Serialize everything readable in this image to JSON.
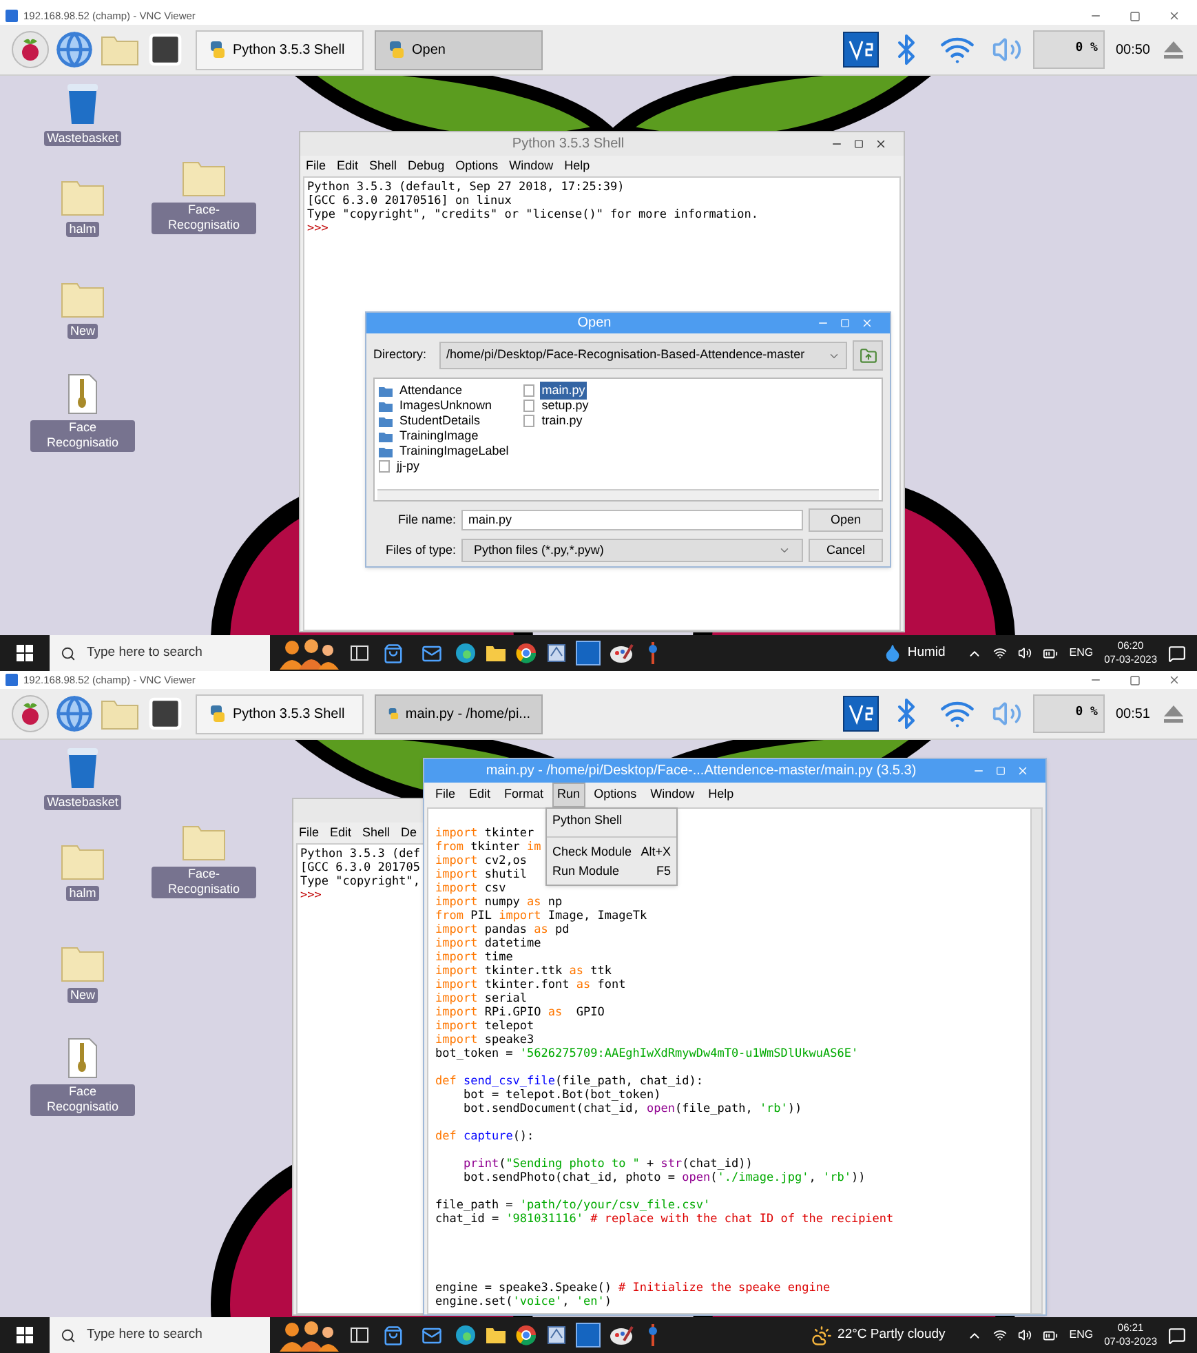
{
  "screens": [
    {
      "vnc_title": "192.168.98.52 (champ) - VNC Viewer",
      "pi_taskbar": {
        "tasks": [
          {
            "label": "Python 3.5.3 Shell",
            "selected": false
          },
          {
            "label": "Open",
            "selected": true
          }
        ],
        "cpu": "0 %",
        "clock": "00:50"
      },
      "desktop_icons": [
        {
          "kind": "trash",
          "label": "Wastebasket"
        },
        {
          "kind": "folder",
          "label": "halm"
        },
        {
          "kind": "folder",
          "label": "Face-Recognisatio"
        },
        {
          "kind": "folder",
          "label": "New"
        },
        {
          "kind": "zip",
          "label": "Face Recognisatio"
        }
      ],
      "windows": [
        {
          "kind": "shell",
          "title": "Python 3.5.3 Shell",
          "menu": [
            "File",
            "Edit",
            "Shell",
            "Debug",
            "Options",
            "Window",
            "Help"
          ],
          "lines": [
            {
              "kind": "output",
              "text": "Python 3.5.3 (default, Sep 27 2018, 17:25:39)"
            },
            {
              "kind": "output",
              "text": "[GCC 6.3.0 20170516] on linux"
            },
            {
              "kind": "output",
              "text": "Type \"copyright\", \"credits\" or \"license()\" for more information."
            },
            {
              "kind": "prompt",
              "text": ">>>"
            }
          ]
        },
        {
          "kind": "open_dialog",
          "title": "Open",
          "directory_label": "Directory:",
          "directory": "/home/pi/Desktop/Face-Recognisation-Based-Attendence-master",
          "file_columns": [
            {
              "items": [
                {
                  "kind": "folder",
                  "label": "Attendance",
                  "selected": false
                },
                {
                  "kind": "folder",
                  "label": "ImagesUnknown",
                  "selected": false
                },
                {
                  "kind": "folder",
                  "label": "StudentDetails",
                  "selected": false
                },
                {
                  "kind": "folder",
                  "label": "TrainingImage",
                  "selected": false
                },
                {
                  "kind": "folder",
                  "label": "TrainingImageLabel",
                  "selected": false
                },
                {
                  "kind": "file",
                  "label": "jj-py",
                  "selected": false
                }
              ]
            },
            {
              "items": [
                {
                  "kind": "file",
                  "label": "main.py",
                  "selected": true
                },
                {
                  "kind": "file",
                  "label": "setup.py",
                  "selected": false
                },
                {
                  "kind": "file",
                  "label": "train.py",
                  "selected": false
                }
              ]
            }
          ],
          "file_name_label": "File name:",
          "file_name": "main.py",
          "file_type_label": "Files of type:",
          "file_type": "Python files (*.py,*.pyw)",
          "buttons": [
            "Open",
            "Cancel"
          ]
        }
      ],
      "windows_taskbar": {
        "search_placeholder": "Type here to search",
        "weather": {
          "kind": "drop",
          "text": "Humid"
        },
        "language": "ENG",
        "time": "06:20",
        "date": "07-03-2023"
      }
    },
    {
      "vnc_title": "192.168.98.52 (champ) - VNC Viewer",
      "pi_taskbar": {
        "tasks": [
          {
            "label": "Python 3.5.3 Shell",
            "selected": false
          },
          {
            "label": "main.py - /home/pi...",
            "selected": true
          }
        ],
        "cpu": "0 %",
        "clock": "00:51"
      },
      "desktop_icons": [
        {
          "kind": "trash",
          "label": "Wastebasket"
        },
        {
          "kind": "folder",
          "label": "halm"
        },
        {
          "kind": "folder",
          "label": "Face-Recognisatio"
        },
        {
          "kind": "folder",
          "label": "New"
        },
        {
          "kind": "zip",
          "label": "Face Recognisatio"
        }
      ],
      "windows": [
        {
          "kind": "shell",
          "menu": [
            "File",
            "Edit",
            "Shell",
            "De"
          ],
          "lines": [
            {
              "kind": "output",
              "text": "Python 3.5.3 (def"
            },
            {
              "kind": "output",
              "text": "[GCC 6.3.0 201705"
            },
            {
              "kind": "output",
              "text": "Type \"copyright\","
            },
            {
              "kind": "prompt",
              "text": ">>>"
            }
          ]
        },
        {
          "kind": "editor",
          "title": "main.py - /home/pi/Desktop/Face-...Attendence-master/main.py (3.5.3)",
          "menu": [
            {
              "label": "File",
              "selected": false
            },
            {
              "label": "Edit",
              "selected": false
            },
            {
              "label": "Format",
              "selected": false
            },
            {
              "label": "Run",
              "selected": true
            },
            {
              "label": "Options",
              "selected": false
            },
            {
              "label": "Window",
              "selected": false
            },
            {
              "label": "Help",
              "selected": false
            }
          ],
          "dropdown": [
            {
              "kind": "item",
              "label": "Python Shell"
            },
            {
              "kind": "separator"
            },
            {
              "kind": "item",
              "label": "Check Module",
              "shortcut": "Alt+X"
            },
            {
              "kind": "item",
              "label": "Run Module",
              "shortcut": "F5"
            }
          ],
          "code": [
            {
              "kind": "code",
              "tokens": [
                {
                  "kind": "keyword",
                  "text": "import"
                },
                {
                  "kind": "plain",
                  "text": " tkinter"
                }
              ]
            },
            {
              "kind": "code",
              "tokens": [
                {
                  "kind": "keyword",
                  "text": "from"
                },
                {
                  "kind": "plain",
                  "text": " tkinter "
                },
                {
                  "kind": "keyword",
                  "text": "im"
                }
              ]
            },
            {
              "kind": "code",
              "tokens": [
                {
                  "kind": "keyword",
                  "text": "import"
                },
                {
                  "kind": "plain",
                  "text": " cv2,os"
                }
              ]
            },
            {
              "kind": "code",
              "tokens": [
                {
                  "kind": "keyword",
                  "text": "import"
                },
                {
                  "kind": "plain",
                  "text": " shutil"
                }
              ]
            },
            {
              "kind": "code",
              "tokens": [
                {
                  "kind": "keyword",
                  "text": "import"
                },
                {
                  "kind": "plain",
                  "text": " csv"
                }
              ]
            },
            {
              "kind": "code",
              "tokens": [
                {
                  "kind": "keyword",
                  "text": "import"
                },
                {
                  "kind": "plain",
                  "text": " numpy "
                },
                {
                  "kind": "keyword",
                  "text": "as"
                },
                {
                  "kind": "plain",
                  "text": " np"
                }
              ]
            },
            {
              "kind": "code",
              "tokens": [
                {
                  "kind": "keyword",
                  "text": "from"
                },
                {
                  "kind": "plain",
                  "text": " PIL "
                },
                {
                  "kind": "keyword",
                  "text": "import"
                },
                {
                  "kind": "plain",
                  "text": " Image, ImageTk"
                }
              ]
            },
            {
              "kind": "code",
              "tokens": [
                {
                  "kind": "keyword",
                  "text": "import"
                },
                {
                  "kind": "plain",
                  "text": " pandas "
                },
                {
                  "kind": "keyword",
                  "text": "as"
                },
                {
                  "kind": "plain",
                  "text": " pd"
                }
              ]
            },
            {
              "kind": "code",
              "tokens": [
                {
                  "kind": "keyword",
                  "text": "import"
                },
                {
                  "kind": "plain",
                  "text": " datetime"
                }
              ]
            },
            {
              "kind": "code",
              "tokens": [
                {
                  "kind": "keyword",
                  "text": "import"
                },
                {
                  "kind": "plain",
                  "text": " time"
                }
              ]
            },
            {
              "kind": "code",
              "tokens": [
                {
                  "kind": "keyword",
                  "text": "import"
                },
                {
                  "kind": "plain",
                  "text": " tkinter.ttk "
                },
                {
                  "kind": "keyword",
                  "text": "as"
                },
                {
                  "kind": "plain",
                  "text": " ttk"
                }
              ]
            },
            {
              "kind": "code",
              "tokens": [
                {
                  "kind": "keyword",
                  "text": "import"
                },
                {
                  "kind": "plain",
                  "text": " tkinter.font "
                },
                {
                  "kind": "keyword",
                  "text": "as"
                },
                {
                  "kind": "plain",
                  "text": " font"
                }
              ]
            },
            {
              "kind": "code",
              "tokens": [
                {
                  "kind": "keyword",
                  "text": "import"
                },
                {
                  "kind": "plain",
                  "text": " serial"
                }
              ]
            },
            {
              "kind": "code",
              "tokens": [
                {
                  "kind": "keyword",
                  "text": "import"
                },
                {
                  "kind": "plain",
                  "text": " RPi.GPIO "
                },
                {
                  "kind": "keyword",
                  "text": "as"
                },
                {
                  "kind": "plain",
                  "text": "  GPIO"
                }
              ]
            },
            {
              "kind": "code",
              "tokens": [
                {
                  "kind": "keyword",
                  "text": "import"
                },
                {
                  "kind": "plain",
                  "text": " telepot"
                }
              ]
            },
            {
              "kind": "code",
              "tokens": [
                {
                  "kind": "keyword",
                  "text": "import"
                },
                {
                  "kind": "plain",
                  "text": " speake3"
                }
              ]
            },
            {
              "kind": "code",
              "tokens": [
                {
                  "kind": "plain",
                  "text": "bot_token = "
                },
                {
                  "kind": "string",
                  "text": "'5626275709:AAEghIwXdRmywDw4mT0-u1WmSDlUkwuAS6E'"
                }
              ]
            },
            {
              "kind": "blank"
            },
            {
              "kind": "code",
              "tokens": [
                {
                  "kind": "keyword",
                  "text": "def "
                },
                {
                  "kind": "definition",
                  "text": "send_csv_file"
                },
                {
                  "kind": "plain",
                  "text": "(file_path, chat_id):"
                }
              ]
            },
            {
              "kind": "indented_code",
              "tokens": [
                {
                  "kind": "plain",
                  "text": "bot = telepot.Bot(bot_token)"
                }
              ]
            },
            {
              "kind": "indented_code",
              "tokens": [
                {
                  "kind": "plain",
                  "text": "bot.sendDocument(chat_id, "
                },
                {
                  "kind": "builtin",
                  "text": "open"
                },
                {
                  "kind": "plain",
                  "text": "(file_path, "
                },
                {
                  "kind": "string",
                  "text": "'rb'"
                },
                {
                  "kind": "plain",
                  "text": "))"
                }
              ]
            },
            {
              "kind": "blank"
            },
            {
              "kind": "code",
              "tokens": [
                {
                  "kind": "keyword",
                  "text": "def "
                },
                {
                  "kind": "definition",
                  "text": "capture"
                },
                {
                  "kind": "plain",
                  "text": "():"
                }
              ]
            },
            {
              "kind": "blank"
            },
            {
              "kind": "indented_code",
              "tokens": [
                {
                  "kind": "builtin",
                  "text": "print"
                },
                {
                  "kind": "plain",
                  "text": "("
                },
                {
                  "kind": "string",
                  "text": "\"Sending photo to \""
                },
                {
                  "kind": "plain",
                  "text": " + "
                },
                {
                  "kind": "builtin",
                  "text": "str"
                },
                {
                  "kind": "plain",
                  "text": "(chat_id))"
                }
              ]
            },
            {
              "kind": "indented_code",
              "tokens": [
                {
                  "kind": "plain",
                  "text": "bot.sendPhoto(chat_id, photo = "
                },
                {
                  "kind": "builtin",
                  "text": "open"
                },
                {
                  "kind": "plain",
                  "text": "("
                },
                {
                  "kind": "string",
                  "text": "'./image.jpg'"
                },
                {
                  "kind": "plain",
                  "text": ", "
                },
                {
                  "kind": "string",
                  "text": "'rb'"
                },
                {
                  "kind": "plain",
                  "text": "))"
                }
              ]
            },
            {
              "kind": "blank"
            },
            {
              "kind": "code",
              "tokens": [
                {
                  "kind": "plain",
                  "text": "file_path = "
                },
                {
                  "kind": "string",
                  "text": "'path/to/your/csv_file.csv'"
                }
              ]
            },
            {
              "kind": "code",
              "tokens": [
                {
                  "kind": "plain",
                  "text": "chat_id = "
                },
                {
                  "kind": "string",
                  "text": "'981031116'"
                },
                {
                  "kind": "comment",
                  "text": " # replace with the chat ID of the recipient"
                }
              ]
            },
            {
              "kind": "blank"
            },
            {
              "kind": "blank"
            },
            {
              "kind": "blank"
            },
            {
              "kind": "blank"
            },
            {
              "kind": "code",
              "tokens": [
                {
                  "kind": "plain",
                  "text": "engine = speake3.Speake()"
                },
                {
                  "kind": "comment",
                  "text": " # Initialize the speake engine"
                }
              ]
            },
            {
              "kind": "code",
              "tokens": [
                {
                  "kind": "plain",
                  "text": "engine.set("
                },
                {
                  "kind": "string",
                  "text": "'voice'"
                },
                {
                  "kind": "plain",
                  "text": ", "
                },
                {
                  "kind": "string",
                  "text": "'en'"
                },
                {
                  "kind": "plain",
                  "text": ")"
                }
              ]
            }
          ]
        }
      ],
      "windows_taskbar": {
        "search_placeholder": "Type here to search",
        "weather": {
          "kind": "sun_cloud",
          "text": "22°C Partly cloudy"
        },
        "language": "ENG",
        "time": "06:21",
        "date": "07-03-2023"
      }
    }
  ]
}
